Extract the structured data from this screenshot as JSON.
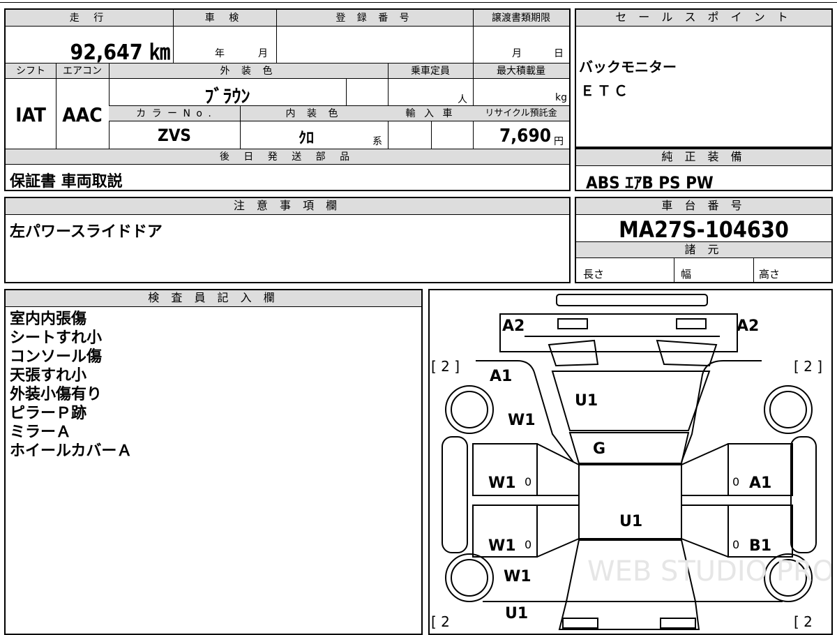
{
  "top": {
    "mileage_label": "走 行",
    "mileage": "92,647 ㎞",
    "inspection_label": "車 検",
    "inspection_year": "年",
    "inspection_month": "月",
    "reg_label": "登 録 番 号",
    "transfer_label": "譲渡書類期限",
    "transfer_month": "月",
    "transfer_day": "日"
  },
  "specs": {
    "shift_label": "シフト",
    "shift": "IAT",
    "ac_label": "エアコン",
    "ac": "AAC",
    "color_label": "外 装 色",
    "color": "ﾌﾞﾗｳﾝ",
    "capacity_label": "乗車定員",
    "capacity_unit": "人",
    "load_label": "最大積載量",
    "load_unit": "kg",
    "color_no_label": "カ ラ ー N o .",
    "color_no": "ZVS",
    "interior_label": "内 装 色",
    "interior": "ｸﾛ",
    "interior_unit": "系",
    "import_label": "輸 入 車",
    "recycle_label": "リサイクル預託金",
    "recycle": "7,690",
    "recycle_unit": "円",
    "later_label": "後 日 発 送 部 品",
    "later": "保証書 車両取説"
  },
  "sales": {
    "label": "セ ー ル ス ポ イ ン ト",
    "items": [
      "バックモニター",
      "ＥＴＣ"
    ]
  },
  "equipment": {
    "label": "純 正 装 備",
    "value": "ABS ｴｱB PS PW"
  },
  "notes": {
    "label": "注 意 事 項 欄",
    "value": "左パワースライドドア"
  },
  "chassis": {
    "label": "車 台 番 号",
    "value": "MA27S-104630",
    "dims_label": "諸 元",
    "length": "長さ",
    "width": "幅",
    "height": "高さ"
  },
  "inspector": {
    "label": "検 査 員 記 入 欄",
    "items": [
      "室内内張傷",
      "シートすれ小",
      "コンソール傷",
      "天張すれ小",
      "外装小傷有り",
      "ピラーＰ跡",
      "ミラーＡ",
      "ホイールカバーＡ"
    ]
  },
  "diagram": {
    "marks": {
      "a2_left": "A2",
      "a2_right": "A2",
      "tire_fl": "[ 2 ]",
      "tire_fr": "[ 2 ]",
      "tire_rl": "[ 2",
      "tire_rr": "[ 2",
      "a1_front": "A1",
      "w1_front": "W1",
      "u1_hood": "U1",
      "g_glass": "G",
      "w1_left_front": "W1",
      "a1_right_front": "A1",
      "u1_roof": "U1",
      "w1_left_rear": "W1",
      "b1_right_rear": "B1",
      "w1_rear": "W1",
      "u1_rear": "U1",
      "zero1": "0",
      "zero2": "0",
      "zero3": "0",
      "zero4": "0"
    },
    "watermark": "WEB STUDIO PRO"
  }
}
